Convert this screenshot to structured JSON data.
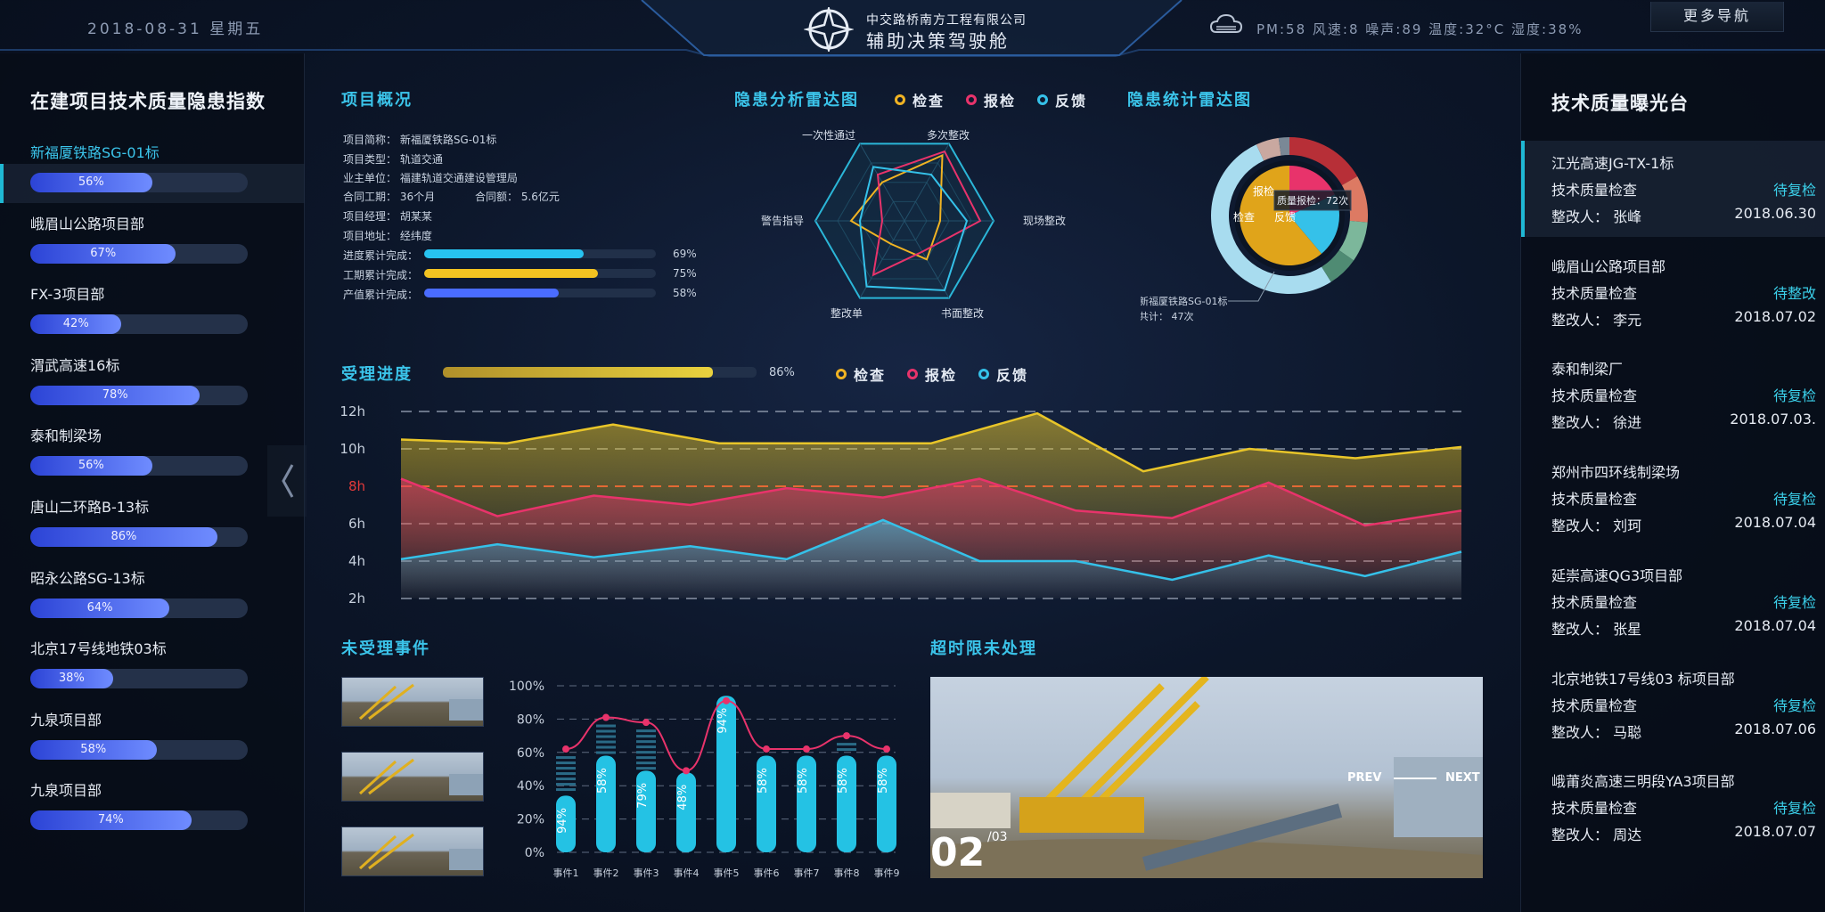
{
  "header": {
    "date": "2018-08-31 星期五",
    "company": "中交路桥南方工程有限公司",
    "system": "辅助决策驾驶舱",
    "env": "PM:58  风速:8  噪声:89  温度:32°C  湿度:38%",
    "more_nav": "更多导航"
  },
  "left": {
    "title": "在建项目技术质量隐患指数",
    "items": [
      {
        "name": "新福厦铁路SG-01标",
        "pct": 0.56,
        "label": "56%"
      },
      {
        "name": "峨眉山公路项目部",
        "pct": 0.67,
        "label": "67%"
      },
      {
        "name": "FX-3项目部",
        "pct": 0.42,
        "label": "42%"
      },
      {
        "name": "渭武高速16标",
        "pct": 0.78,
        "label": "78%"
      },
      {
        "name": "泰和制梁场",
        "pct": 0.56,
        "label": "56%"
      },
      {
        "name": "唐山二环路B-13标",
        "pct": 0.86,
        "label": "86%"
      },
      {
        "name": "昭永公路SG-13标",
        "pct": 0.64,
        "label": "64%"
      },
      {
        "name": "北京17号线地铁03标",
        "pct": 0.38,
        "label": "38%"
      },
      {
        "name": "九泉项目部",
        "pct": 0.58,
        "label": "58%"
      },
      {
        "name": "九泉项目部",
        "pct": 0.74,
        "label": "74%"
      }
    ]
  },
  "overview": {
    "title": "项目概况",
    "rows": [
      "项目简称：  新福厦铁路SG-01标",
      "项目类型：  轨道交通",
      "业主单位：  福建轨道交通建设管理局",
      "合同工期：  36个月",
      "项目经理：  胡某某",
      "项目地址：  经纬度"
    ],
    "contract_amount": "合同额：  5.6亿元",
    "progress": [
      {
        "label": "进度累计完成：",
        "pct": 0.69,
        "text": "69%",
        "color": "#27c3f0"
      },
      {
        "label": "工期累计完成：",
        "pct": 0.75,
        "text": "75%",
        "color": "#f3c321"
      },
      {
        "label": "产值累计完成：",
        "pct": 0.58,
        "text": "58%",
        "color": "#4a6cff"
      }
    ]
  },
  "radar1": {
    "title": "隐患分析雷达图",
    "legend": [
      {
        "name": "检查",
        "color": "#f0b323"
      },
      {
        "name": "报检",
        "color": "#e8336b"
      },
      {
        "name": "反馈",
        "color": "#35c1e9"
      }
    ],
    "axes": [
      "多次整改",
      "现场整改",
      "书面整改",
      "整改单",
      "警告指导",
      "一次性通过"
    ]
  },
  "radar2": {
    "title": "隐患统计雷达图",
    "tooltip": "质量报检：72次",
    "project": "新福厦铁路SG-01标",
    "total": "共计：  47次",
    "inner": [
      "检查",
      "报检",
      "反馈"
    ]
  },
  "progress_title": "受理进度",
  "progress_pct": 0.86,
  "progress_text": "86%",
  "chart_legend": [
    {
      "name": "检查",
      "color": "#f0b323"
    },
    {
      "name": "报检",
      "color": "#e8336b"
    },
    {
      "name": "反馈",
      "color": "#35c1e9"
    }
  ],
  "chart_data": [
    {
      "type": "area",
      "yticks": [
        "2h",
        "4h",
        "6h",
        "8h",
        "10h",
        "12h"
      ],
      "ylim": [
        2,
        12
      ],
      "threshold": 8,
      "series": [
        {
          "name": "检查",
          "color": "#e8c529",
          "values": [
            10.5,
            10.3,
            11.3,
            10.3,
            10.3,
            10.3,
            11.9,
            8.8,
            10,
            9.5,
            10.1
          ]
        },
        {
          "name": "报检",
          "color": "#e8336b",
          "values": [
            8.4,
            6.4,
            7.5,
            7.0,
            7.9,
            7.4,
            8.4,
            6.7,
            6.3,
            8.2,
            5.9,
            6.7
          ]
        },
        {
          "name": "反馈",
          "color": "#35c1e9",
          "values": [
            4.1,
            4.9,
            4.2,
            4.8,
            4.1,
            6.2,
            4.0,
            4.0,
            3.0,
            4.3,
            3.2,
            4.5
          ]
        }
      ]
    },
    {
      "type": "bar",
      "categories": [
        "事件1",
        "事件2",
        "事件3",
        "事件4",
        "事件5",
        "事件6",
        "事件7",
        "事件8",
        "事件9"
      ],
      "values": [
        34,
        58,
        49,
        48,
        94,
        58,
        58,
        58,
        58
      ],
      "bar_labels": [
        "94%",
        "58%",
        "79%",
        "48%",
        "94%",
        "58%",
        "58%",
        "58%",
        "58%"
      ],
      "line": [
        62,
        81,
        78,
        49,
        91,
        62,
        62,
        70,
        62
      ],
      "yticks": [
        "0%",
        "20%",
        "40%",
        "60%",
        "80%",
        "100%"
      ],
      "ylim": [
        0,
        100
      ]
    }
  ],
  "unaccepted_title": "未受理事件",
  "overdue": {
    "title": "超时限未处理",
    "prev": "PREV",
    "next": "NEXT",
    "index": "02",
    "total": "/03"
  },
  "right": {
    "title": "技术质量曝光台",
    "items": [
      {
        "project": "江光高速JG-TX-1标",
        "type": "技术质量检查",
        "status": "待复检",
        "person": "整改人：  张峰",
        "date": "2018.06.30"
      },
      {
        "project": "峨眉山公路项目部",
        "type": "技术质量检查",
        "status": "待整改",
        "person": "整改人：  李元",
        "date": "2018.07.02"
      },
      {
        "project": "泰和制梁厂",
        "type": "技术质量检查",
        "status": "待复检",
        "person": "整改人：  徐进",
        "date": "2018.07.03."
      },
      {
        "project": "郑州市四环线制梁场",
        "type": "技术质量检查",
        "status": "待复检",
        "person": "整改人：  刘珂",
        "date": "2018.07.04"
      },
      {
        "project": "延崇高速QG3项目部",
        "type": "技术质量检查",
        "status": "待复检",
        "person": "整改人：  张星",
        "date": "2018.07.04"
      },
      {
        "project": "北京地铁17号线03 标项目部",
        "type": "技术质量检查",
        "status": "待复检",
        "person": "整改人：  马聪",
        "date": "2018.07.06"
      },
      {
        "project": "峨莆炎高速三明段YA3项目部",
        "type": "技术质量检查",
        "status": "待复检",
        "person": "整改人：  周达",
        "date": "2018.07.07"
      }
    ]
  },
  "colors": {
    "accent": "#3bc4ea",
    "bg": "#0c1629"
  }
}
